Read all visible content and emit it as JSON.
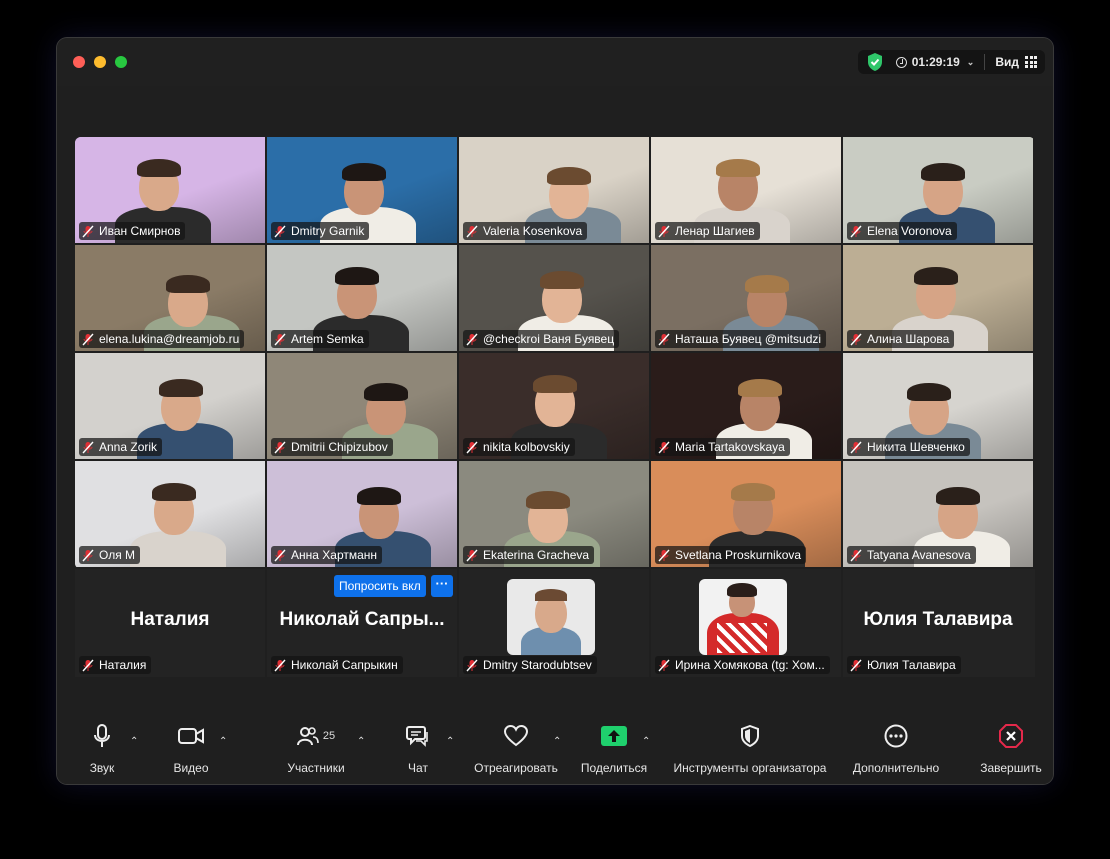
{
  "titlebar": {
    "timer": "01:29:19",
    "view_label": "Вид"
  },
  "tiles": [
    {
      "name": "Иван Смирнов",
      "bg": "#d6b5e6"
    },
    {
      "name": "Dmitry Garnik",
      "bg": "#2b6ea8",
      "active": true
    },
    {
      "name": "Valeria Kosenkova",
      "bg": "#d9d2c6"
    },
    {
      "name": "Ленар Шагиев",
      "bg": "#e6e0d6"
    },
    {
      "name": "Elena Voronova",
      "bg": "#c9ccc3"
    },
    {
      "name": "elena.lukina@dreamjob.ru",
      "bg": "#8a7b66"
    },
    {
      "name": "Artem Semka",
      "bg": "#c4c6c2"
    },
    {
      "name": "@checkroi Ваня Буявец",
      "bg": "#55524c"
    },
    {
      "name": "Наташа Буявец @mitsudzi",
      "bg": "#7b6f62"
    },
    {
      "name": "Алина Шарова",
      "bg": "#bcae94"
    },
    {
      "name": "Anna Zorik",
      "bg": "#d3d1cd"
    },
    {
      "name": "Dmitrii Chipizubov",
      "bg": "#8f8778"
    },
    {
      "name": "nikita kolbovskiy",
      "bg": "#3a2d2a"
    },
    {
      "name": "Maria Tartakovskaya",
      "bg": "#2a1c1a"
    },
    {
      "name": "Никита Шевченко",
      "bg": "#d6d4cf"
    },
    {
      "name": "Оля М",
      "bg": "#e0e0e2"
    },
    {
      "name": "Анна Хартманн",
      "bg": "#cdbfd8"
    },
    {
      "name": "Ekaterina Gracheva",
      "bg": "#8b8a7f"
    },
    {
      "name": "Svetlana Proskurnikova",
      "bg": "#d98d5a"
    },
    {
      "name": "Tatyana Avanesova",
      "bg": "#c6c3be"
    }
  ],
  "bottom_tiles": [
    {
      "big_name": "Наталия",
      "name": "Наталия"
    },
    {
      "big_name": "Николай Сапры...",
      "name": "Николай Сапрыкин"
    },
    {
      "big_name": "",
      "name": "Dmitry Starodubtsev"
    },
    {
      "big_name": "",
      "name": "Ирина Хомякова (tg: Хом..."
    },
    {
      "big_name": "Юлия Талавира",
      "name": "Юлия Талавира"
    }
  ],
  "ask_button": "Попросить вкл",
  "more_button": "···",
  "toolbar": {
    "audio": "Звук",
    "video": "Видео",
    "participants": "Участники",
    "participants_count": "25",
    "chat": "Чат",
    "react": "Отреагировать",
    "share": "Поделиться",
    "host_tools": "Инструменты организатора",
    "more": "Дополнительно",
    "end": "Завершить"
  },
  "colors": {
    "share_green": "#1fd06d",
    "end_red": "#e5294b",
    "accent_blue": "#0e71eb",
    "active_speaker": "#3ecf5b"
  }
}
